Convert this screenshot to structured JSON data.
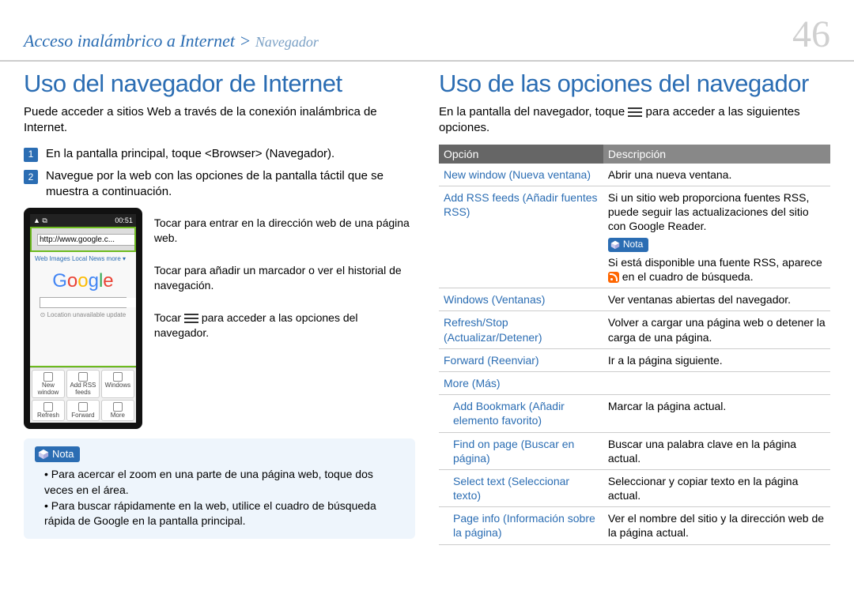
{
  "header": {
    "breadcrumb_main": "Acceso inalámbrico a Internet",
    "breadcrumb_sep": ">",
    "breadcrumb_sub": "Navegador",
    "page_number": "46"
  },
  "left": {
    "title": "Uso del navegador de Internet",
    "intro": "Puede acceder a sitios Web a través de la conexión inalámbrica de Internet.",
    "steps": [
      "En la pantalla principal, toque <Browser> (Navegador).",
      "Navegue por la web con las opciones de la pantalla táctil que se muestra a continuación."
    ],
    "phone": {
      "time": "00:51",
      "url": "http://www.google.c...",
      "tabs": "Web  Images  Local  News  more ▾",
      "location": "⊙ Location unavailable update",
      "menu": [
        "New window",
        "Add RSS feeds",
        "Windows",
        "Refresh",
        "Forward",
        "More"
      ]
    },
    "callouts": [
      "Tocar para entrar en la dirección web de una página web.",
      "Tocar para añadir un marcador o ver el historial de navegación.",
      "Tocar  para acceder a las opciones del navegador."
    ],
    "callout_menu_insert": "Tocar ",
    "callout_menu_suffix": " para acceder a las opciones del navegador.",
    "nota_label": "Nota",
    "nota_items": [
      "Para acercar el zoom en una parte de una página web, toque dos veces en el área.",
      "Para buscar rápidamente en la web, utilice el cuadro de búsqueda rápida de Google en la pantalla principal."
    ]
  },
  "right": {
    "title": "Uso de las opciones del navegador",
    "intro_pre": "En la pantalla del navegador, toque ",
    "intro_post": " para acceder a las siguientes opciones.",
    "th_option": "Opción",
    "th_desc": "Descripción",
    "nota_label": "Nota",
    "rows": [
      {
        "opt": "New window (Nueva ventana)",
        "desc": "Abrir una nueva ventana."
      },
      {
        "opt": "Add RSS feeds (Añadir fuentes RSS)",
        "desc_pre": "Si un sitio web proporciona fuentes RSS, puede seguir las actualizaciones del sitio con Google Reader.",
        "nota": "Si está disponible una fuente RSS, aparece  en el cuadro de búsqueda.",
        "nota_pre": "Si está disponible una fuente RSS, aparece ",
        "nota_post": " en el cuadro de búsqueda."
      },
      {
        "opt": "Windows (Ventanas)",
        "desc": "Ver ventanas abiertas del navegador."
      },
      {
        "opt": "Refresh/Stop (Actualizar/Detener)",
        "desc": "Volver a cargar una página web o detener la carga de una página."
      },
      {
        "opt": "Forward (Reenviar)",
        "desc": "Ir a la página siguiente."
      },
      {
        "opt": "More (Más)",
        "desc": ""
      },
      {
        "opt": "Add Bookmark (Añadir elemento favorito)",
        "desc": "Marcar la página actual.",
        "indent": true
      },
      {
        "opt": "Find on page (Buscar en página)",
        "desc": "Buscar una palabra clave en la página actual.",
        "indent": true
      },
      {
        "opt": "Select text (Seleccionar texto)",
        "desc": "Seleccionar y copiar texto en la página actual.",
        "indent": true
      },
      {
        "opt": "Page info (Información sobre la página)",
        "desc": "Ver el nombre del sitio y la dirección web de la página actual.",
        "indent": true
      }
    ]
  }
}
